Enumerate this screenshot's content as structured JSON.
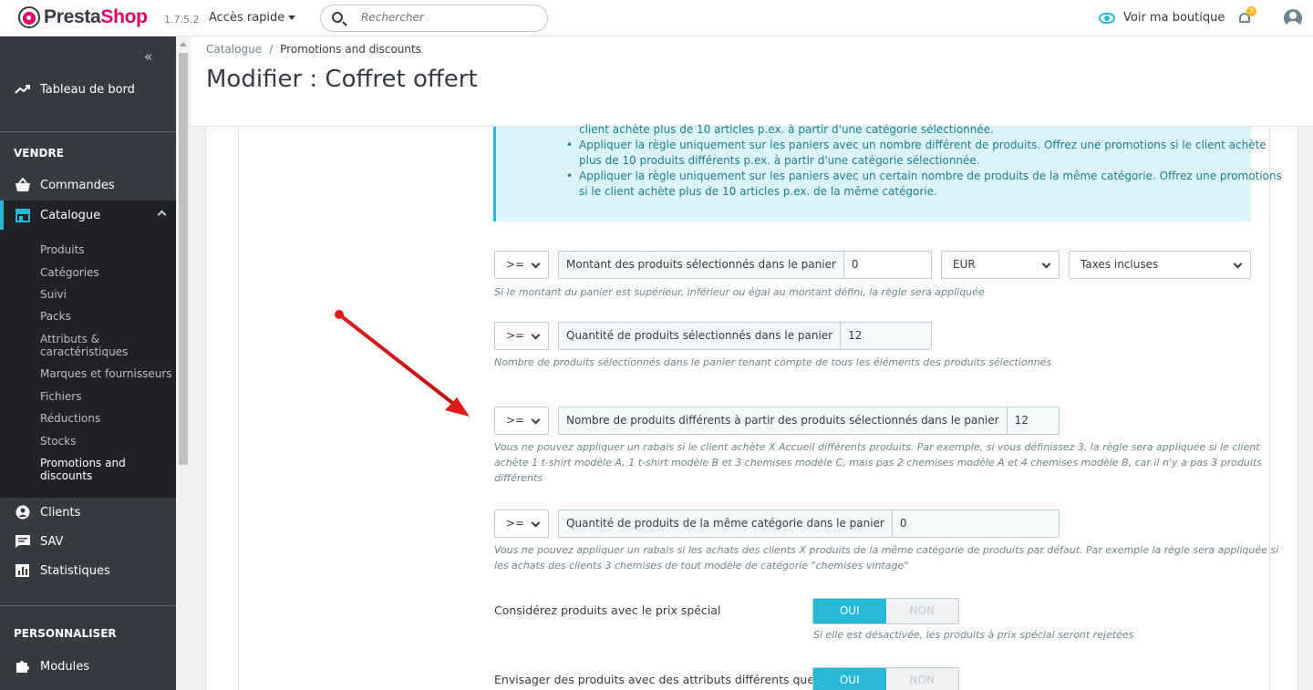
{
  "topbar": {
    "logo_prefix": "Presta",
    "logo_suffix": "Shop",
    "version": "1.7.5.2",
    "quick_access": "Accès rapide",
    "search_placeholder": "Rechercher",
    "view_shop": "Voir ma boutique",
    "notifications_count": "3"
  },
  "sidebar": {
    "collapse_icon": "«",
    "dashboard": "Tableau de bord",
    "section_sell": "VENDRE",
    "orders": "Commandes",
    "catalogue": "Catalogue",
    "catalogue_sub": [
      "Produits",
      "Catégories",
      "Suivi",
      "Packs",
      "Attributs &",
      "caractéristiques",
      "Marques et fournisseurs",
      "Fichiers",
      "Réductions",
      "Stocks",
      "Promotions and",
      "discounts"
    ],
    "clients": "Clients",
    "sav": "SAV",
    "stats": "Statistiques",
    "section_customize": "PERSONNALISER",
    "modules": "Modules"
  },
  "header": {
    "breadcrumb_1": "Catalogue",
    "breadcrumb_sep": "/",
    "breadcrumb_2": "Promotions and discounts",
    "title": "Modifier : Coffret offert"
  },
  "info": {
    "line0": "client achète plus de 10 articles p.ex. à partir d'une catégorie sélectionnée.",
    "line1": "Appliquer la règle uniquement sur les paniers avec un nombre différent de produits. Offrez une promotions si le client achète",
    "line2": "plus de 10 produits différents p.ex. à partir d'une catégorie sélectionnée.",
    "line3": "Appliquer la règle uniquement sur les paniers avec un certain nombre de produits de la même catégorie. Offrez une promotions",
    "line4": "si le client achète plus de 10 articles p.ex. de la même catégorie."
  },
  "rows": {
    "amount": {
      "operator": ">=",
      "label": "Montant des produits sélectionnés dans le panier",
      "value": "0",
      "currency": "EUR",
      "tax": "Taxes incluses",
      "help": "Si le montant du panier est supérieur, inférieur ou égal au montant défini, la règle sera appliquée"
    },
    "quantity": {
      "operator": ">=",
      "label": "Quantité de produits sélectionnés dans le panier",
      "value": "12",
      "help": "Nombre de produits sélectionnés dans le panier tenant compte de tous les éléments des produits sélectionnés"
    },
    "different": {
      "operator": ">=",
      "label": "Nombre de produits différents à partir des produits sélectionnés dans le panier",
      "value": "12",
      "help1": "Vous ne pouvez appliquer un rabais si le client achète X Accueil différents produits. Par exemple, si vous définissez 3, la règle sera appliquée si le client",
      "help2": "achète 1 t-shirt modèle A, 1 t-shirt modèle B et 3 chemises modèle C, mais pas 2 chemises modèle A et 4 chemises modèle B, car il n'y a pas 3 produits",
      "help3": "différents"
    },
    "same_category": {
      "operator": ">=",
      "label": "Quantité de produits de la même catégorie dans le panier",
      "value": "0",
      "help1": "Vous ne pouvez appliquer un rabais si les achats des clients X produits de la même catégorie de produits par défaut. Par exemple la règle sera appliquée si",
      "help2": "les achats des clients 3 chemises de tout modèle de catégorie \"chemises vintage\""
    },
    "special_price": {
      "label": "Considérez produits avec le prix spécial",
      "on": "OUI",
      "off": "NON",
      "help": "Si elle est désactivée, les produits à prix spécial seront rejetées"
    },
    "attributes": {
      "label": "Envisager des produits avec des attributs différents que",
      "on": "OUI",
      "off": "NON"
    }
  },
  "colors": {
    "accent": "#25b9d7",
    "annotation_arrow": "#e01b1b"
  }
}
